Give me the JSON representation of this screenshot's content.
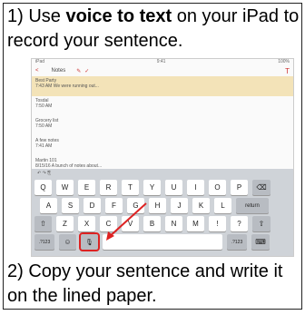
{
  "step1": {
    "prefix": "1) Use ",
    "bold": "voice to text",
    "suffix": " on your iPad to record your sentence."
  },
  "step2": {
    "text": "2) Copy your sentence and write it on the lined paper."
  },
  "shot": {
    "nav": {
      "back": "<",
      "title": "Notes"
    },
    "notes": [
      {
        "title": "Best Party",
        "sub": "7:43 AM  We were running out..."
      },
      {
        "title": "Tosdal",
        "sub": "7:50 AM"
      },
      {
        "title": "Grocery list",
        "sub": "7:50 AM"
      },
      {
        "title": "A few notes",
        "sub": "7:41 AM"
      },
      {
        "title": "Martin 101",
        "sub": "8/15/16  A bunch of notes about..."
      }
    ],
    "keys": {
      "row1": [
        "Q",
        "W",
        "E",
        "R",
        "T",
        "Y",
        "U",
        "I",
        "O",
        "P",
        "⌫"
      ],
      "row2": [
        "A",
        "S",
        "D",
        "F",
        "G",
        "H",
        "J",
        "K",
        "L",
        "return"
      ],
      "row3": [
        "⇧",
        "Z",
        "X",
        "C",
        "V",
        "B",
        "N",
        "M",
        "!",
        "?",
        "⇧"
      ],
      "row4": [
        ".?123",
        "☺",
        "🎙",
        "",
        ".?123",
        "⌨"
      ]
    }
  },
  "colors": {
    "highlight": "#d22",
    "selected_note": "#f3e3b8"
  }
}
